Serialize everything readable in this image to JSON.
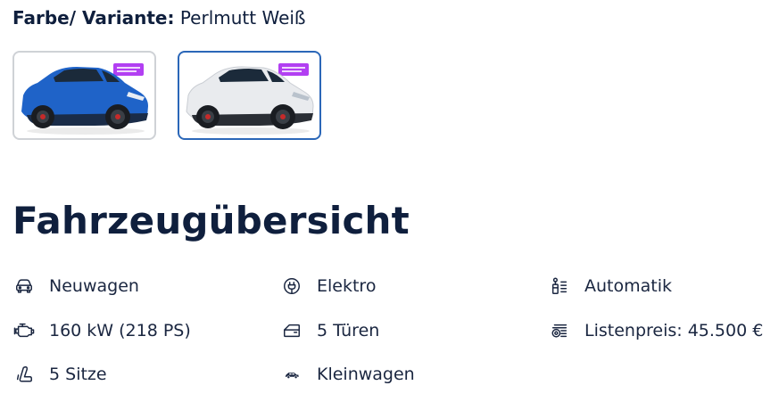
{
  "variant": {
    "label": "Farbe/ Variante:",
    "value": "Perlmutt Weiß"
  },
  "swatches": [
    {
      "color_name": "blue",
      "body_color": "#1f63c8",
      "badge_color": "#b23ff2",
      "selected": false
    },
    {
      "color_name": "pearl-white",
      "body_color": "#e9ebee",
      "badge_color": "#b23ff2",
      "selected": true
    }
  ],
  "overview": {
    "title": "Fahrzeugübersicht",
    "features": [
      {
        "icon": "car-front-icon",
        "text": "Neuwagen"
      },
      {
        "icon": "plug-icon",
        "text": "Elektro"
      },
      {
        "icon": "gear-shift-icon",
        "text": "Automatik"
      },
      {
        "icon": "engine-icon",
        "text": "160 kW (218 PS)"
      },
      {
        "icon": "car-door-icon",
        "text": "5 Türen"
      },
      {
        "icon": "price-tag-icon",
        "text": "Listenpreis: 45.500 €"
      },
      {
        "icon": "car-seat-icon",
        "text": "5 Sitze"
      },
      {
        "icon": "small-car-icon",
        "text": "Kleinwagen"
      }
    ]
  },
  "colors": {
    "text_dark": "#0f1f3d",
    "selected_border": "#2b67b8",
    "unselected_border": "#cfd2d6"
  }
}
